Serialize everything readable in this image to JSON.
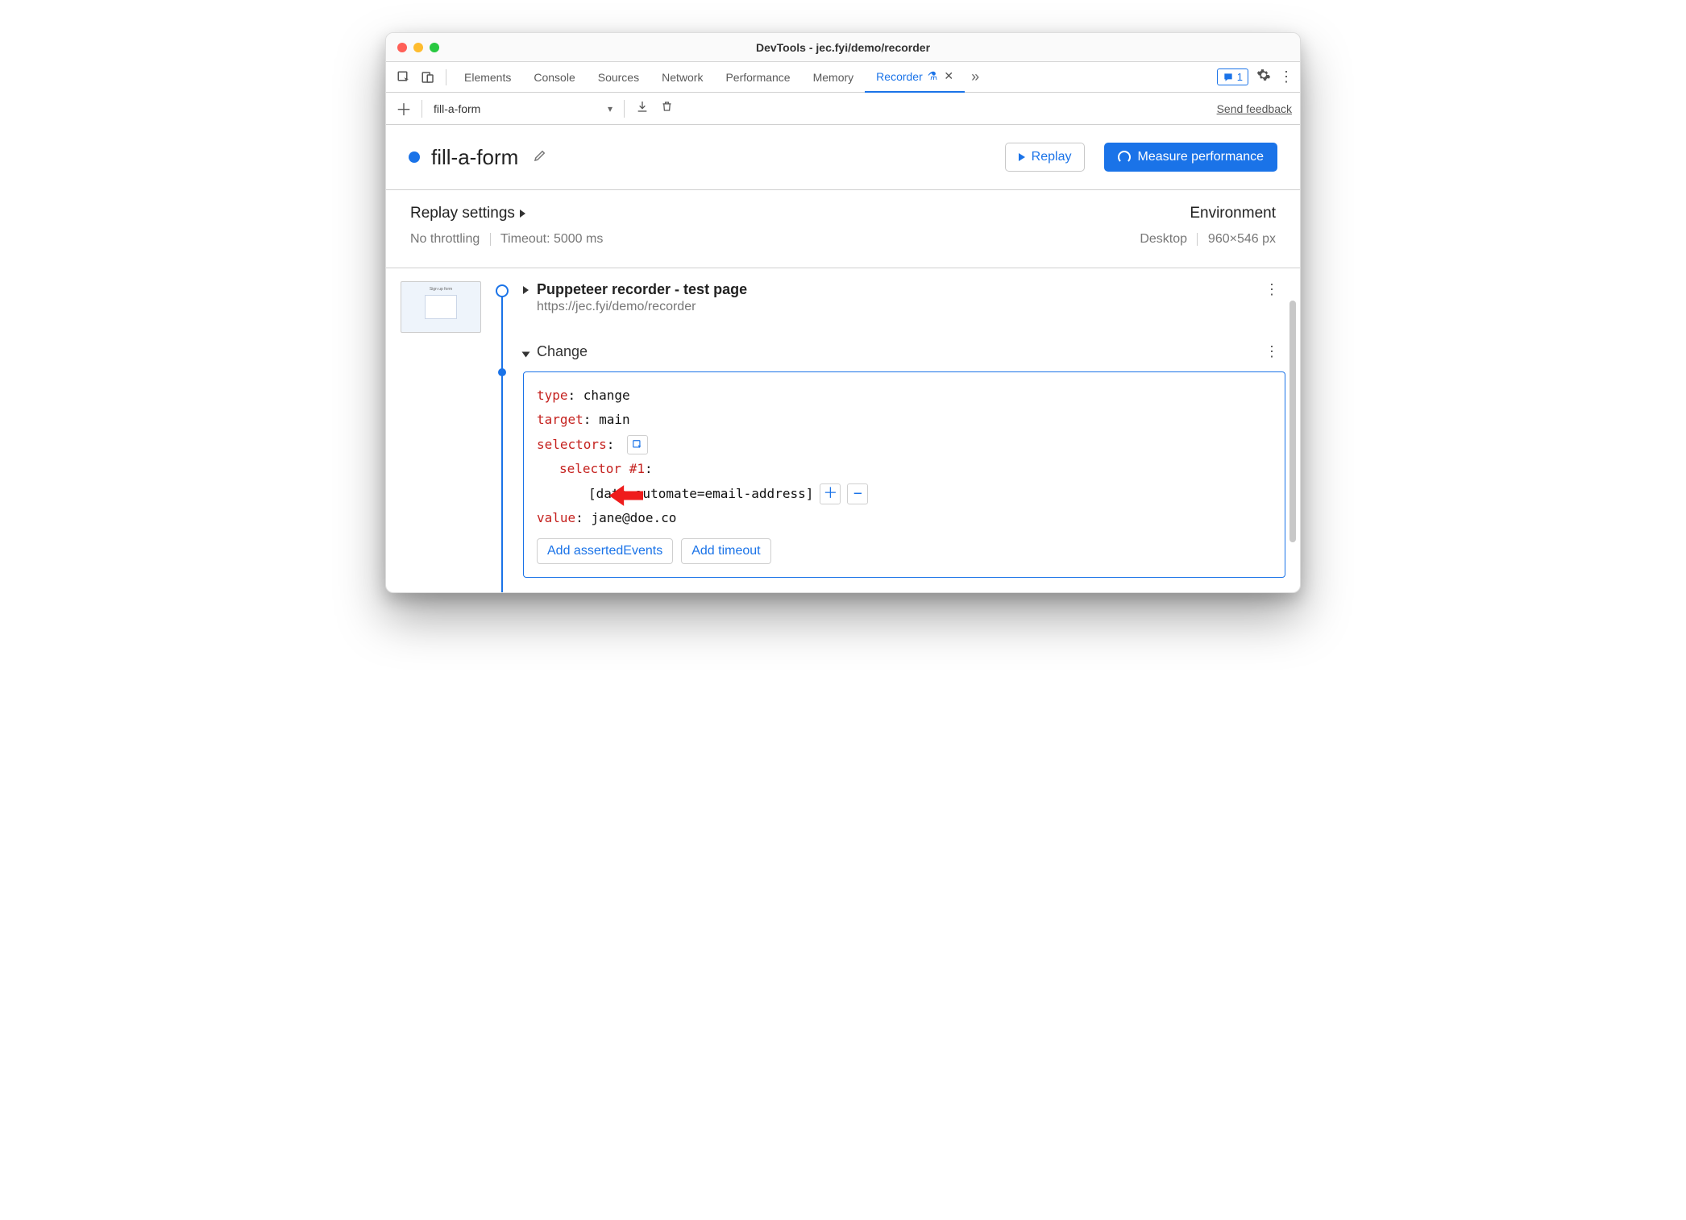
{
  "window": {
    "title": "DevTools - jec.fyi/demo/recorder"
  },
  "tabbar": {
    "tabs": [
      "Elements",
      "Console",
      "Sources",
      "Network",
      "Performance",
      "Memory"
    ],
    "active_tab": "Recorder",
    "messages_count": "1"
  },
  "toolbar": {
    "recording_name": "fill-a-form",
    "send_feedback": "Send feedback"
  },
  "header": {
    "title": "fill-a-form",
    "replay_label": "Replay",
    "measure_label": "Measure performance"
  },
  "settings": {
    "replay_heading": "Replay settings",
    "throttling": "No throttling",
    "timeout": "Timeout: 5000 ms",
    "env_heading": "Environment",
    "device": "Desktop",
    "viewport": "960×546 px"
  },
  "step_start": {
    "title": "Puppeteer recorder - test page",
    "url": "https://jec.fyi/demo/recorder"
  },
  "step_change": {
    "label": "Change",
    "fields": {
      "type_key": "type",
      "type_val": "change",
      "target_key": "target",
      "target_val": "main",
      "selectors_key": "selectors",
      "selector1_key": "selector #1",
      "selector1_val": "[data-automate=email-address]",
      "value_key": "value",
      "value_val": "jane@doe.co"
    },
    "add_asserted": "Add assertedEvents",
    "add_timeout": "Add timeout"
  }
}
